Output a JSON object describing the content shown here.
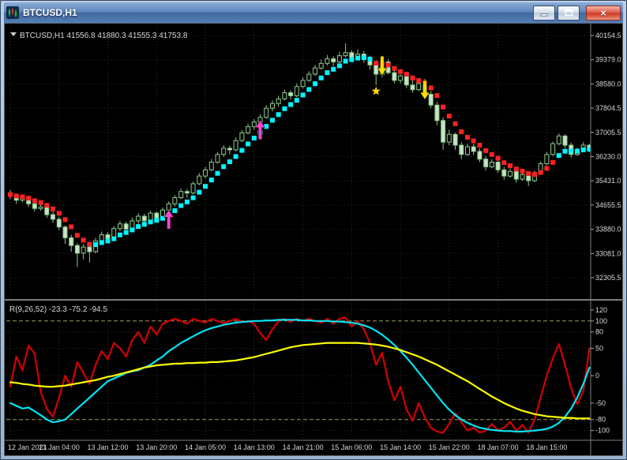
{
  "window": {
    "title": "BTCUSD,H1",
    "controls": {
      "minimize": "minimize",
      "restore": "restore",
      "close": "close"
    }
  },
  "main_header": {
    "expand_icon": "dropdown-triangle",
    "symbol_period": "BTCUSD,H1",
    "open": "41556.8",
    "high": "41880.3",
    "low": "41555.3",
    "close": "41753.8",
    "ohlc_line": "BTCUSD,H1 41556.8 41880.3 41555.3 41753.8"
  },
  "indicator_header": {
    "name": "R(9,26,52)",
    "values": [
      "-23.3",
      "-75.2",
      "-94.5"
    ],
    "label": "R(9,26,52) -23.3 -75.2 -94.5"
  },
  "chart_data": [
    {
      "type": "candlestick",
      "symbol": "BTCUSD",
      "timeframe": "H1",
      "price_axis_labels": [
        "40154.5",
        "39379.0",
        "38580.0",
        "37804.5",
        "37005.5",
        "36230.0",
        "35431.0",
        "34655.5",
        "33880.0",
        "33081.0",
        "32305.5"
      ],
      "time_axis_labels": [
        "12 Jan 2021",
        "13 Jan 04:00",
        "13 Jan 12:00",
        "13 Jan 20:00",
        "14 Jan 05:00",
        "14 Jan 13:00",
        "14 Jan 21:00",
        "15 Jan 06:00",
        "15 Jan 14:00",
        "15 Jan 22:00",
        "18 Jan 07:00",
        "18 Jan 15:00"
      ],
      "bars_per_label": 8,
      "colors": {
        "background": "#000000",
        "candle_outline": "#8cc88c",
        "bull_fill": "#0a0a0a",
        "bear_fill": "#c4e4c4",
        "up_trend_dots": "#00f6ff",
        "down_trend_dots": "#ff2222",
        "buy_arrow": "#ff44cc",
        "sell_arrow": "#ffdd00",
        "star": "#ffd700",
        "grid": "#2f2f2f",
        "axis_text": "#d8d8d8"
      },
      "candles": [
        [
          35050,
          35150,
          34850,
          34950
        ],
        [
          34950,
          35000,
          34700,
          34820
        ],
        [
          34820,
          34980,
          34750,
          34900
        ],
        [
          34900,
          34950,
          34600,
          34700
        ],
        [
          34700,
          34780,
          34450,
          34550
        ],
        [
          34550,
          34700,
          34480,
          34600
        ],
        [
          34600,
          34650,
          34250,
          34350
        ],
        [
          34350,
          34450,
          34080,
          34200
        ],
        [
          34200,
          34280,
          33850,
          33950
        ],
        [
          33950,
          34000,
          33400,
          33600
        ],
        [
          33600,
          33700,
          33150,
          33350
        ],
        [
          33350,
          33420,
          32650,
          33100
        ],
        [
          33100,
          33400,
          32900,
          33300
        ],
        [
          33300,
          33380,
          32800,
          33150
        ],
        [
          33150,
          33600,
          33100,
          33500
        ],
        [
          33500,
          33800,
          33400,
          33700
        ],
        [
          33700,
          33780,
          33450,
          33580
        ],
        [
          33580,
          33980,
          33500,
          33900
        ],
        [
          33900,
          34150,
          33820,
          34050
        ],
        [
          34050,
          34120,
          33780,
          33880
        ],
        [
          33880,
          34250,
          33850,
          34150
        ],
        [
          34150,
          34400,
          34050,
          34300
        ],
        [
          34300,
          34380,
          34020,
          34150
        ],
        [
          34150,
          34480,
          34100,
          34400
        ],
        [
          34400,
          34450,
          34120,
          34250
        ],
        [
          34250,
          34580,
          34200,
          34500
        ],
        [
          34500,
          34780,
          34420,
          34700
        ],
        [
          34700,
          34980,
          34620,
          34900
        ],
        [
          34900,
          35200,
          34850,
          35100
        ],
        [
          35100,
          35180,
          34900,
          35050
        ],
        [
          35050,
          35420,
          35000,
          35350
        ],
        [
          35350,
          35700,
          35300,
          35600
        ],
        [
          35600,
          35900,
          35520,
          35800
        ],
        [
          35800,
          36150,
          35750,
          36050
        ],
        [
          36050,
          36380,
          36000,
          36300
        ],
        [
          36300,
          36600,
          36220,
          36500
        ],
        [
          36500,
          36580,
          36300,
          36450
        ],
        [
          36450,
          36850,
          36400,
          36750
        ],
        [
          36750,
          37100,
          36700,
          37000
        ],
        [
          37000,
          37300,
          36950,
          37200
        ],
        [
          37200,
          37450,
          37100,
          37350
        ],
        [
          37350,
          37600,
          37250,
          37500
        ],
        [
          37500,
          37900,
          37450,
          37800
        ],
        [
          37800,
          38050,
          37700,
          37950
        ],
        [
          37950,
          38200,
          37850,
          38100
        ],
        [
          38100,
          38400,
          38050,
          38300
        ],
        [
          38300,
          38380,
          38080,
          38200
        ],
        [
          38200,
          38600,
          38150,
          38500
        ],
        [
          38500,
          38800,
          38450,
          38700
        ],
        [
          38700,
          39000,
          38650,
          38900
        ],
        [
          38900,
          39200,
          38850,
          39100
        ],
        [
          39100,
          39380,
          39050,
          39250
        ],
        [
          39250,
          39520,
          39180,
          39400
        ],
        [
          39400,
          39480,
          39150,
          39300
        ],
        [
          39300,
          39620,
          39250,
          39500
        ],
        [
          39500,
          39900,
          39450,
          39600
        ],
        [
          39600,
          39680,
          39300,
          39450
        ],
        [
          39450,
          39700,
          39380,
          39550
        ],
        [
          39550,
          39650,
          39280,
          39400
        ],
        [
          39400,
          39500,
          39050,
          39200
        ],
        [
          39200,
          39350,
          38550,
          38900
        ],
        [
          38900,
          39500,
          38800,
          39300
        ],
        [
          39300,
          39380,
          38900,
          38950
        ],
        [
          38950,
          39050,
          38600,
          38700
        ],
        [
          38700,
          38900,
          38600,
          38850
        ],
        [
          38850,
          38950,
          38450,
          38550
        ],
        [
          38550,
          38700,
          38300,
          38400
        ],
        [
          38400,
          38650,
          38350,
          38600
        ],
        [
          38600,
          38750,
          38150,
          38250
        ],
        [
          38250,
          38350,
          37800,
          37900
        ],
        [
          37900,
          38000,
          37250,
          37400
        ],
        [
          37400,
          37500,
          36450,
          36700
        ],
        [
          36700,
          37100,
          36600,
          36950
        ],
        [
          36950,
          37000,
          36450,
          36600
        ],
        [
          36600,
          36700,
          36150,
          36300
        ],
        [
          36300,
          36650,
          36250,
          36550
        ],
        [
          36550,
          36650,
          36280,
          36400
        ],
        [
          36400,
          36500,
          36050,
          36150
        ],
        [
          36150,
          36250,
          35780,
          35900
        ],
        [
          35900,
          36150,
          35850,
          36050
        ],
        [
          36050,
          36100,
          35700,
          35800
        ],
        [
          35800,
          35900,
          35480,
          35600
        ],
        [
          35600,
          35850,
          35550,
          35750
        ],
        [
          35750,
          35800,
          35380,
          35500
        ],
        [
          35500,
          35750,
          35450,
          35650
        ],
        [
          35650,
          35700,
          35280,
          35450
        ],
        [
          35450,
          35780,
          35400,
          35700
        ],
        [
          35700,
          36080,
          35650,
          36000
        ],
        [
          36000,
          36380,
          35950,
          36300
        ],
        [
          36300,
          36720,
          36250,
          36650
        ],
        [
          36650,
          36980,
          36600,
          36900
        ],
        [
          36900,
          36950,
          36500,
          36600
        ],
        [
          36600,
          36680,
          36200,
          36300
        ],
        [
          36300,
          36520,
          36250,
          36450
        ],
        [
          36450,
          36700,
          36400,
          36600
        ],
        [
          36600,
          36650,
          36380,
          36500
        ]
      ],
      "trend_segments": [
        {
          "from": 0,
          "to": 13,
          "trend": "down"
        },
        {
          "from": 14,
          "to": 59,
          "trend": "up"
        },
        {
          "from": 60,
          "to": 89,
          "trend": "down"
        },
        {
          "from": 90,
          "to": 95,
          "trend": "up"
        }
      ],
      "signals": [
        {
          "bar": 26,
          "type": "buy-arrow",
          "price": 34500
        },
        {
          "bar": 41,
          "type": "buy-arrow",
          "price": 37400
        },
        {
          "bar": 60,
          "type": "star",
          "price": 38350
        },
        {
          "bar": 61,
          "type": "sell-arrow",
          "price": 38870
        },
        {
          "bar": 68,
          "type": "sell-arrow",
          "price": 38080
        }
      ]
    },
    {
      "type": "line",
      "name": "R(9,26,52)",
      "displayed_values": "-23.3 -75.2 -94.5",
      "y_range": [
        130,
        -115
      ],
      "level_line_color": "#9c9c5a",
      "levels": [
        {
          "value": 120,
          "style": "dotted"
        },
        {
          "value": 100,
          "style": "dashed"
        },
        {
          "value": 80,
          "style": "dotted"
        },
        {
          "value": 50,
          "style": "dotted"
        },
        {
          "value": 0,
          "style": "dotted"
        },
        {
          "value": -50,
          "style": "dotted"
        },
        {
          "value": -80,
          "style": "dashed"
        },
        {
          "value": -100,
          "style": "dotted"
        }
      ],
      "series": [
        {
          "name": "fast",
          "color": "#d40000",
          "values": [
            -20,
            35,
            10,
            55,
            40,
            -30,
            -60,
            -75,
            -40,
            0,
            -20,
            25,
            5,
            -15,
            20,
            45,
            30,
            60,
            50,
            35,
            65,
            80,
            60,
            90,
            75,
            95,
            100,
            104,
            100,
            95,
            104,
            100,
            97,
            104,
            100,
            96,
            100,
            104,
            98,
            100,
            95,
            78,
            65,
            85,
            100,
            104,
            98,
            104,
            100,
            104,
            100,
            97,
            104,
            95,
            104,
            106,
            90,
            100,
            85,
            60,
            20,
            42,
            -10,
            -45,
            -20,
            -62,
            -82,
            -50,
            -76,
            -95,
            -102,
            -104,
            -88,
            -68,
            -85,
            -100,
            -95,
            -104,
            -100,
            -88,
            -100,
            -95,
            -84,
            -100,
            -90,
            -104,
            -80,
            -40,
            0,
            32,
            58,
            20,
            -22,
            -52,
            -28,
            50
          ]
        },
        {
          "name": "mid",
          "color": "#00e4f2",
          "values": [
            -50,
            -55,
            -60,
            -58,
            -65,
            -72,
            -80,
            -85,
            -83,
            -80,
            -70,
            -60,
            -50,
            -40,
            -30,
            -20,
            -10,
            -5,
            0,
            5,
            8,
            10,
            15,
            20,
            28,
            35,
            45,
            52,
            60,
            66,
            72,
            78,
            83,
            87,
            90,
            93,
            95,
            97,
            98,
            99,
            100,
            100,
            101,
            101,
            102,
            102,
            102,
            102,
            101,
            101,
            100,
            100,
            100,
            99,
            99,
            98,
            97,
            95,
            92,
            88,
            82,
            75,
            66,
            56,
            45,
            33,
            20,
            6,
            -8,
            -22,
            -36,
            -50,
            -62,
            -72,
            -80,
            -86,
            -91,
            -95,
            -97,
            -99,
            -100,
            -101,
            -101,
            -102,
            -102,
            -101,
            -100,
            -99,
            -97,
            -93,
            -86,
            -75,
            -60,
            -40,
            -15,
            15
          ]
        },
        {
          "name": "slow",
          "color": "#ffff00",
          "values": [
            -12,
            -13,
            -15,
            -16,
            -18,
            -19,
            -20,
            -20,
            -19,
            -18,
            -16,
            -14,
            -12,
            -10,
            -8,
            -5,
            -2,
            0,
            3,
            6,
            9,
            12,
            15,
            17,
            19,
            20,
            21,
            22,
            22,
            23,
            23,
            24,
            24,
            25,
            25,
            26,
            27,
            28,
            30,
            32,
            34,
            37,
            40,
            43,
            46,
            49,
            52,
            54,
            56,
            57,
            58,
            59,
            60,
            60,
            60,
            60,
            60,
            60,
            59,
            58,
            57,
            55,
            53,
            50,
            47,
            43,
            39,
            35,
            30,
            25,
            20,
            14,
            8,
            2,
            -4,
            -10,
            -17,
            -24,
            -31,
            -38,
            -44,
            -50,
            -55,
            -60,
            -64,
            -67,
            -70,
            -72,
            -74,
            -75,
            -76,
            -77,
            -77,
            -78,
            -78,
            -78
          ]
        }
      ]
    }
  ]
}
